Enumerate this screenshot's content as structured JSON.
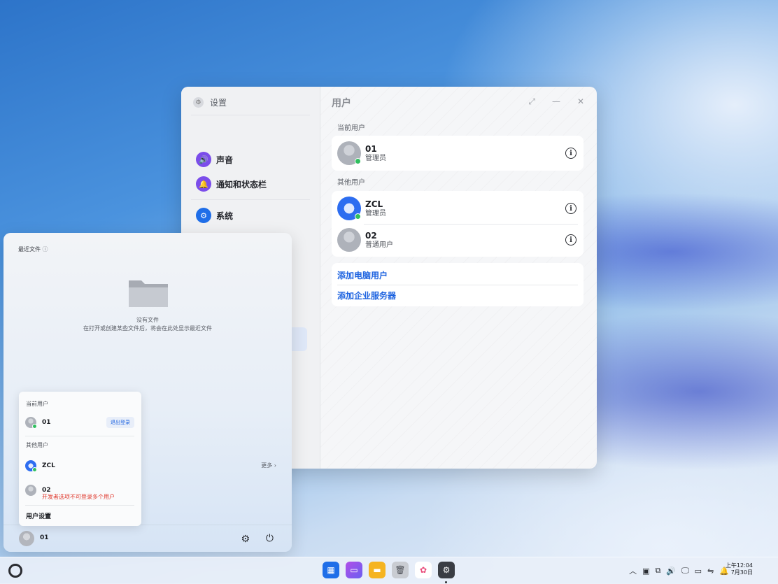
{
  "settings": {
    "app_name": "设置",
    "title": "用户",
    "nav": [
      {
        "label": "声音",
        "icon": "speaker-icon",
        "color": "#7b4dea"
      },
      {
        "label": "通知和状态栏",
        "icon": "bell-icon",
        "color": "#7b4dea"
      },
      {
        "label": "系统",
        "icon": "gear-icon",
        "color": "#1f6ee8"
      }
    ],
    "current_user_label": "当前用户",
    "current_user": {
      "name": "01",
      "role": "管理员"
    },
    "other_users_label": "其他用户",
    "other_users": [
      {
        "name": "ZCL",
        "role": "管理员"
      },
      {
        "name": "02",
        "role": "普通用户"
      }
    ],
    "links": [
      "添加电脑用户",
      "添加企业服务器"
    ]
  },
  "start": {
    "recent_label": "最近文件",
    "empty_title": "没有文件",
    "empty_hint": "在打开或创建某些文件后，将会在此处显示最近文件",
    "more": "更多",
    "bottom_user": "01"
  },
  "popup": {
    "current_label": "当前用户",
    "current_user": "01",
    "logout": "退出登录",
    "other_label": "其他用户",
    "other_users": [
      {
        "name": "ZCL"
      },
      {
        "name": "02",
        "note": "开发者选项不可登录多个用户"
      }
    ],
    "user_settings": "用户设置"
  },
  "taskbar": {
    "time": "上午12:04",
    "date": "7月30日"
  }
}
